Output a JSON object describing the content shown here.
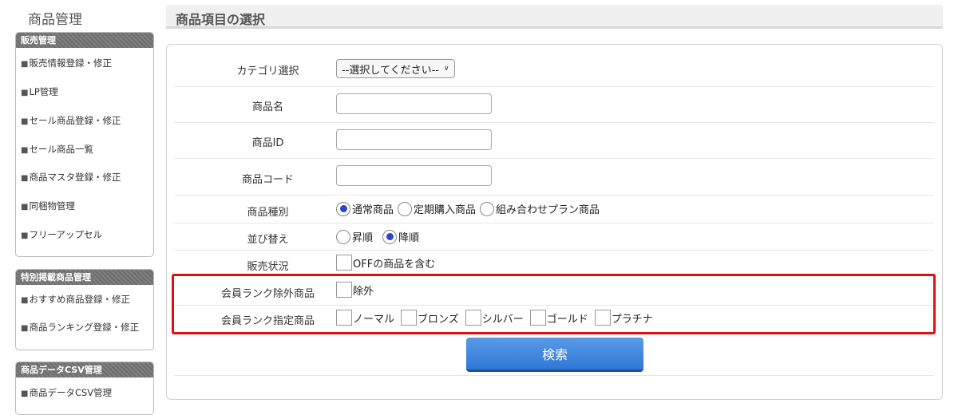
{
  "app": {
    "title": "商品管理"
  },
  "sidebar": {
    "panels": [
      {
        "title": "販売管理",
        "items": [
          "販売情報登録・修正",
          "LP管理",
          "セール商品登録・修正",
          "セール商品一覧",
          "商品マスタ登録・修正",
          "同梱物管理",
          "フリーアップセル"
        ]
      },
      {
        "title": "特別掲載商品管理",
        "items": [
          "おすすめ商品登録・修正",
          "商品ランキング登録・修正"
        ]
      },
      {
        "title": "商品データCSV管理",
        "items": [
          "商品データCSV管理"
        ]
      }
    ],
    "bullet": "■"
  },
  "main": {
    "title": "商品項目の選択",
    "form": {
      "category": {
        "label": "カテゴリ選択",
        "selected": "--選択してください--"
      },
      "product_name": {
        "label": "商品名",
        "value": ""
      },
      "product_id": {
        "label": "商品ID",
        "value": ""
      },
      "product_code": {
        "label": "商品コード",
        "value": ""
      },
      "product_type": {
        "label": "商品種別",
        "options": [
          "通常商品",
          "定期購入商品",
          "組み合わせプラン商品"
        ],
        "selected": "通常商品"
      },
      "sort": {
        "label": "並び替え",
        "options": [
          "昇順",
          "降順"
        ],
        "selected": "降順"
      },
      "sales_status": {
        "label": "販売状況",
        "checkbox_label": "OFFの商品を含む",
        "checked": false
      },
      "member_rank_exclude": {
        "label": "会員ランク除外商品",
        "checkbox_label": "除外",
        "checked": false
      },
      "member_rank_specify": {
        "label": "会員ランク指定商品",
        "options": [
          "ノーマル",
          "ブロンズ",
          "シルバー",
          "ゴールド",
          "プラチナ"
        ]
      }
    },
    "search_button": "検索"
  },
  "colors": {
    "highlight": "#e01010",
    "button": "#2f78d6",
    "radio_selected": "#2a45c8"
  }
}
